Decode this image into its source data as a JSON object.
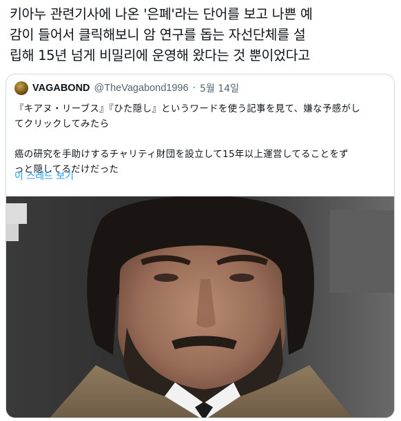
{
  "tweet": {
    "lines": [
      "키아누 관련기사에 나온 '은폐'라는 단어를 보고 나쁜 예",
      "감이 들어서 클릭해보니 암 연구를 돕는 자선단체를 설",
      "립해 15년 넘게 비밀리에 운영해 왔다는 것 뿐이었다고"
    ]
  },
  "quote": {
    "author_name": "VAGABOND",
    "author_handle": "@TheVagabond1996",
    "separator": "·",
    "date": "5월 14일",
    "body_lines_para1": [
      "『キアヌ・リーブス』『ひた隠し』というワードを使う記事を見て、嫌な予感がし",
      "てクリックしてみたら"
    ],
    "body_lines_para2": [
      "癌の研究を手助けするチャリティ財団を設立して15年以上運営してることをず",
      "っと隠してるだけだった"
    ],
    "show_thread_label": "이 스레드 보기"
  },
  "photo": {
    "description_icon": "photo-of-man"
  },
  "colors": {
    "link": "#1d9bf0",
    "muted": "#536471",
    "border": "#cfd9de",
    "text": "#0f1419"
  }
}
